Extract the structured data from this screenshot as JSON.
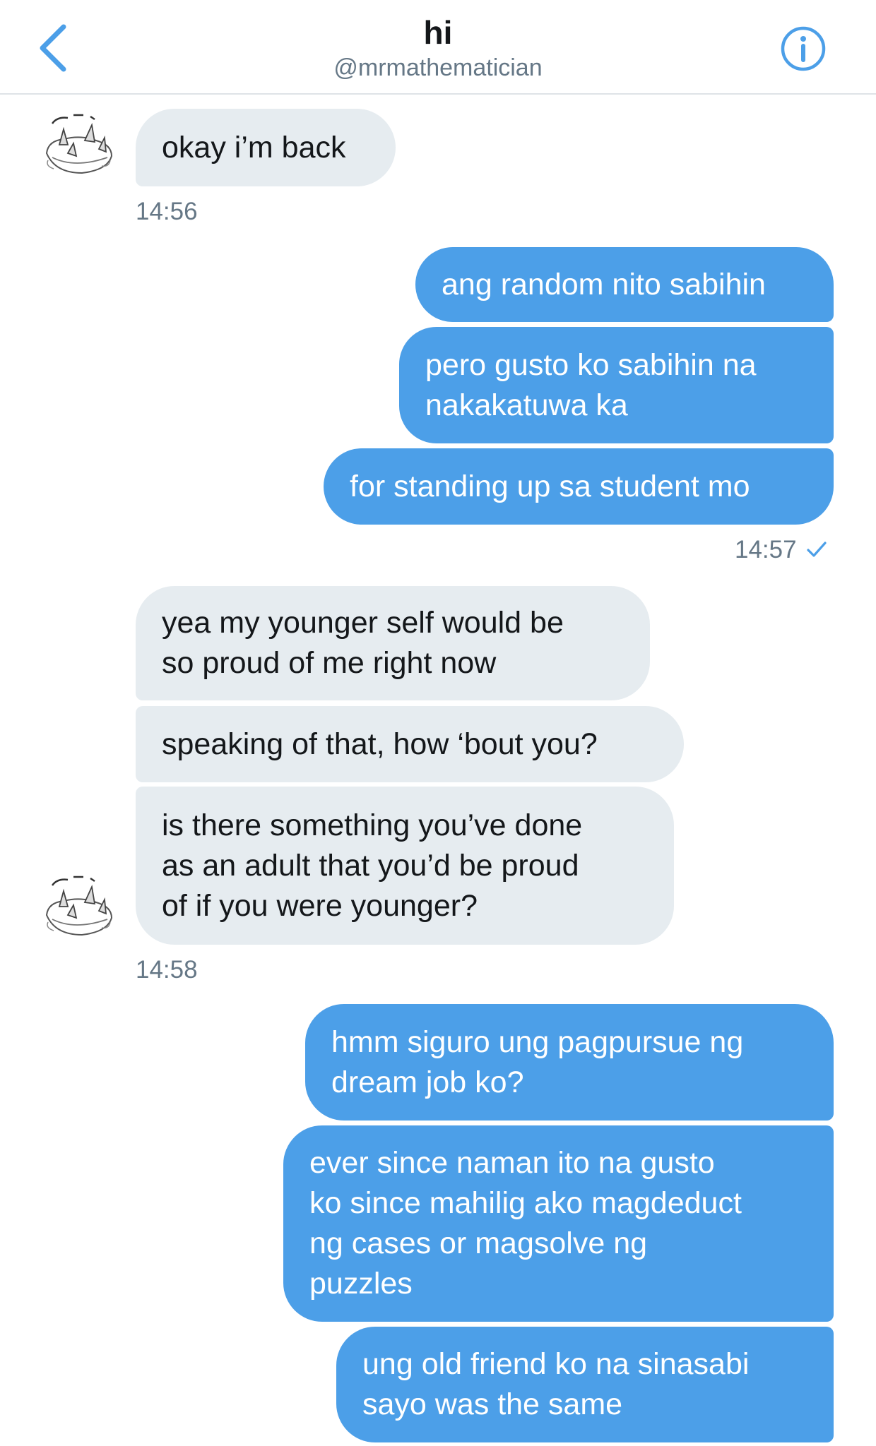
{
  "header": {
    "title": "hi",
    "handle": "@mrmathematician",
    "accent": "#4c9fe8"
  },
  "colors": {
    "incoming_bubble": "#e6ecf0",
    "outgoing_bubble": "#4c9fe8",
    "timestamp": "#657786"
  },
  "messages": [
    {
      "from": "them",
      "text": "okay i’m back"
    },
    {
      "from": "them",
      "time": "14:56"
    },
    {
      "from": "me",
      "text": "ang random nito sabihin"
    },
    {
      "from": "me",
      "text": "pero gusto ko sabihin na\nnakakatuwa ka"
    },
    {
      "from": "me",
      "text": "for standing up sa student mo"
    },
    {
      "from": "me",
      "time": "14:57",
      "status": "check-icon"
    },
    {
      "from": "them",
      "text": "yea my younger self would be\nso proud of me right now"
    },
    {
      "from": "them",
      "text": "speaking of that, how ‘bout you?"
    },
    {
      "from": "them",
      "text": "is there something you’ve done\nas an adult that you’d be proud\nof if you were younger?"
    },
    {
      "from": "them",
      "time": "14:58"
    },
    {
      "from": "me",
      "text": "hmm siguro ung pagpursue ng\ndream job ko?"
    },
    {
      "from": "me",
      "text": "ever since naman ito na gusto\nko since mahilig ako magdeduct\nng cases or magsolve ng\npuzzles"
    },
    {
      "from": "me",
      "text": "ung old friend ko na sinasabi\nsayo was the same"
    }
  ]
}
